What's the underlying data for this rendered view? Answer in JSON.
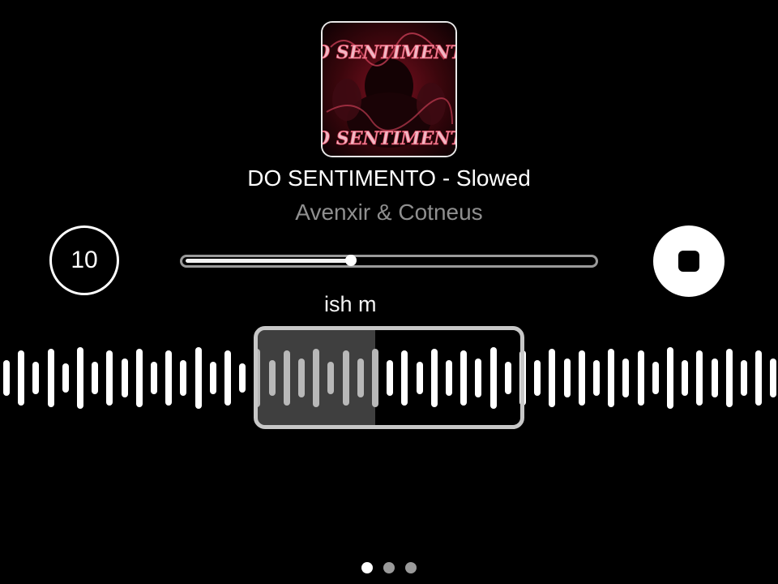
{
  "album": {
    "art_text_top": "DO SENTIMENTO",
    "art_text_bottom": "DO SENTIMENTO",
    "art_palette": {
      "primary": "#c8304a",
      "dark": "#2a0508",
      "light": "#f5d6dc"
    }
  },
  "track": {
    "title": "DO SENTIMENTO - Slowed",
    "artist": "Avenxir & Cotneus"
  },
  "controls": {
    "skip_label": "10",
    "skip_icon": "replay-10-icon",
    "stop_icon": "stop-icon"
  },
  "progress": {
    "fraction": 0.405
  },
  "lyric": {
    "text": "ish m"
  },
  "waveform": {
    "bar_heights": [
      0.55,
      0.85,
      0.5,
      0.9,
      0.45,
      0.95,
      0.5,
      0.85,
      0.6,
      0.9,
      0.5,
      0.85,
      0.55,
      0.95,
      0.5,
      0.85,
      0.45,
      0.9,
      0.55,
      0.85,
      0.6,
      0.9,
      0.5,
      0.85,
      0.6,
      0.9,
      0.55,
      0.85,
      0.5,
      0.9,
      0.55,
      0.85,
      0.6,
      0.95,
      0.5,
      0.85,
      0.55,
      0.9,
      0.6,
      0.85,
      0.55,
      0.9,
      0.6,
      0.85,
      0.5,
      0.95,
      0.55,
      0.85,
      0.6,
      0.9,
      0.55,
      0.85,
      0.6
    ],
    "selection_start_fraction": 0.33,
    "selection_end_fraction": 0.67,
    "selection_played_fraction": 0.44
  },
  "pager": {
    "pages": 3,
    "active_index": 0
  },
  "colors": {
    "background": "#000000",
    "accent": "#ffffff",
    "muted_text": "#8f8f8f"
  }
}
